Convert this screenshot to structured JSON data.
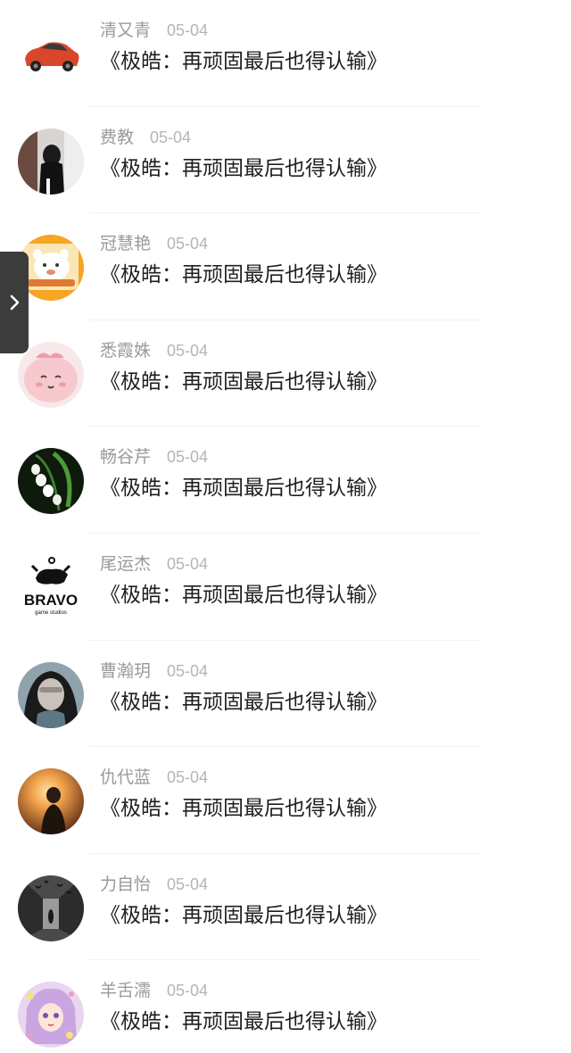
{
  "comments": [
    {
      "name": "清又青",
      "date": "05-04",
      "title": "《极皓：再顽固最后也得认输》",
      "avatar": "red-car-avatar"
    },
    {
      "name": "费教",
      "date": "05-04",
      "title": "《极皓：再顽固最后也得认输》",
      "avatar": "girl-photo-avatar"
    },
    {
      "name": "冠慧艳",
      "date": "05-04",
      "title": "《极皓：再顽固最后也得认输》",
      "avatar": "cartoon-bear-avatar"
    },
    {
      "name": "悉霞姝",
      "date": "05-04",
      "title": "《极皓：再顽固最后也得认输》",
      "avatar": "pink-blob-avatar"
    },
    {
      "name": "畅谷芹",
      "date": "05-04",
      "title": "《极皓：再顽固最后也得认输》",
      "avatar": "lily-flower-avatar"
    },
    {
      "name": "尾运杰",
      "date": "05-04",
      "title": "《极皓：再顽固最后也得认输》",
      "avatar": "bravo-logo-avatar"
    },
    {
      "name": "曹瀚玥",
      "date": "05-04",
      "title": "《极皓：再顽固最后也得认输》",
      "avatar": "hooded-portrait-avatar"
    },
    {
      "name": "仇代蓝",
      "date": "05-04",
      "title": "《极皓：再顽固最后也得认输》",
      "avatar": "sunset-silhouette-avatar"
    },
    {
      "name": "力自怡",
      "date": "05-04",
      "title": "《极皓：再顽固最后也得认输》",
      "avatar": "dark-corridor-avatar"
    },
    {
      "name": "羊舌濡",
      "date": "05-04",
      "title": "《极皓：再顽固最后也得认输》",
      "avatar": "anime-girl-avatar"
    }
  ],
  "avatar_logo_text": "BRAVO",
  "avatar_logo_subtext": "game studios",
  "side_tab": {
    "icon": "chevron-right-icon"
  }
}
